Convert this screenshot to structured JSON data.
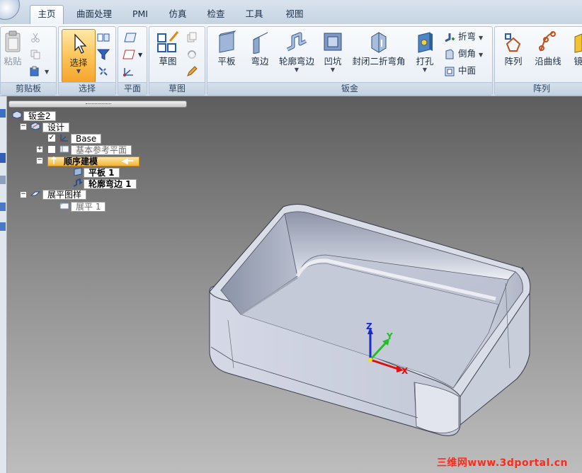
{
  "tabs": [
    {
      "label": "主页",
      "active": true
    },
    {
      "label": "曲面处理"
    },
    {
      "label": "PMI"
    },
    {
      "label": "仿真"
    },
    {
      "label": "检查"
    },
    {
      "label": "工具"
    },
    {
      "label": "视图"
    }
  ],
  "ribbon": {
    "clipboard": {
      "label": "剪贴板",
      "paste": "粘贴"
    },
    "select": {
      "label": "选择",
      "select_button": "选择"
    },
    "plane": {
      "label": "平面"
    },
    "sketch": {
      "label": "草图",
      "sketch_button": "草图"
    },
    "sheetmetal": {
      "label": "钣金",
      "tab": "平板",
      "flange": "弯边",
      "contour_flange": "轮廓弯边",
      "dimple": "凹坑",
      "closed_corner": "封闭二折弯角",
      "punch": "打孔",
      "bend": "折弯",
      "chamfer": "倒角",
      "midplane": "中面"
    },
    "pattern": {
      "label": "阵列",
      "pattern_button": "阵列",
      "along_curve": "沿曲线",
      "mirror": "镜像"
    }
  },
  "tree": {
    "root": "钣金2",
    "design": "设计",
    "base": "Base",
    "ref_planes": "基本参考平面",
    "ordered": "顺序建模",
    "tab_feature": "平板 1",
    "contour_feature": "轮廓弯边 1",
    "flat_pattern": "展平图样",
    "flat": "展平 1"
  },
  "axes": {
    "x": "X",
    "y": "Y",
    "z": "Z"
  },
  "watermark": "三维网www.3dportal.cn",
  "colors": {
    "selection": "#f3b53a",
    "ribbon": "#dfe7f1",
    "part": "#c8cede",
    "axis_x": "#e01010",
    "axis_y": "#20c020",
    "axis_z": "#1a2ad0"
  }
}
